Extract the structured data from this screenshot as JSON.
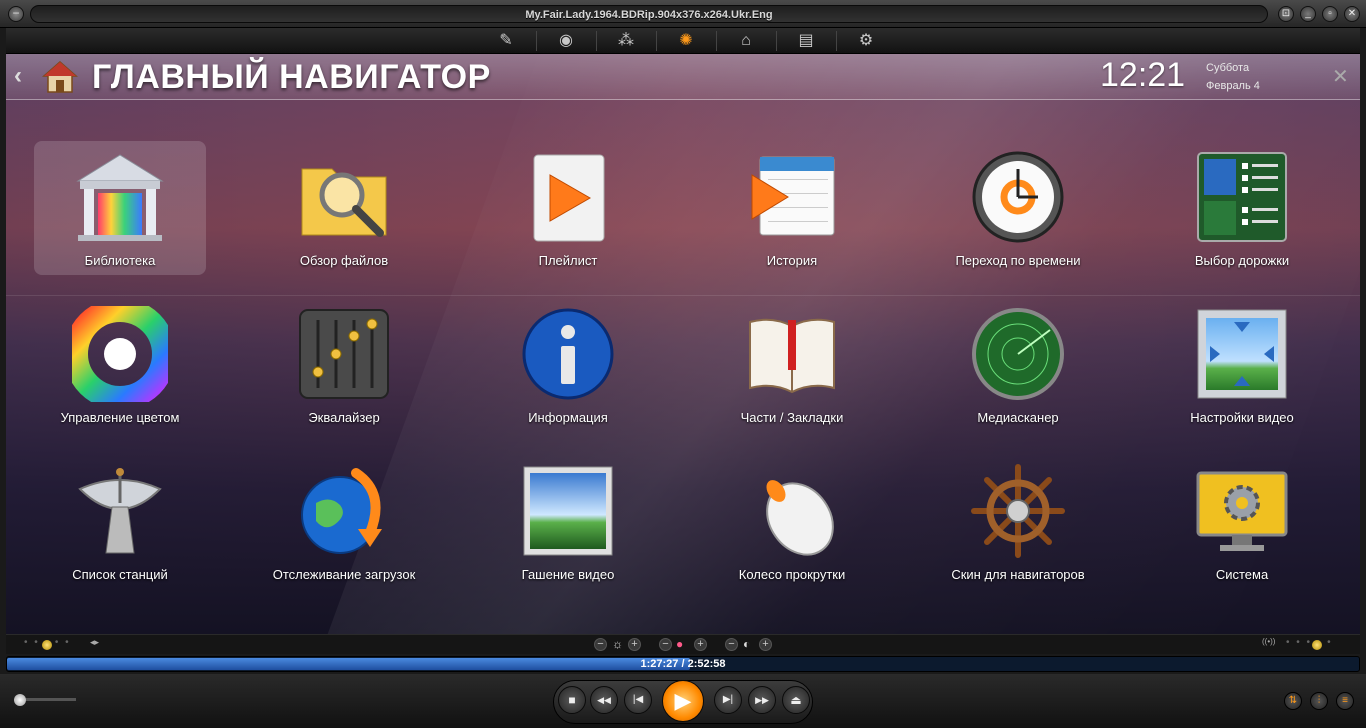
{
  "window": {
    "title": "My.Fair.Lady.1964.BDRip.904x376.x264.Ukr.Eng",
    "menu_glyph": "−",
    "btn_small": "⊡",
    "btn_minimize": "_",
    "btn_maximize": "▫",
    "btn_close": "✕"
  },
  "toolbar": {
    "items": [
      {
        "icon": "brush-icon",
        "glyph": "✎"
      },
      {
        "icon": "broadcast-icon",
        "glyph": "◉"
      },
      {
        "icon": "dots-icon",
        "glyph": "⁂"
      },
      {
        "icon": "navigator-icon",
        "glyph": "✺",
        "active": true
      },
      {
        "icon": "library-icon",
        "glyph": "⌂"
      },
      {
        "icon": "book-icon",
        "glyph": "▤"
      },
      {
        "icon": "settings-icon",
        "glyph": "⚙"
      }
    ]
  },
  "header": {
    "back_glyph": "‹",
    "title": "ГЛАВНЫЙ НАВИГАТОР",
    "time": "12:21",
    "day": "Суббота",
    "date": "Февраль 4",
    "close_glyph": "✕"
  },
  "grid": [
    {
      "label": "Библиотека",
      "icon": "library-icon",
      "selected": true
    },
    {
      "label": "Обзор файлов",
      "icon": "folder-search-icon"
    },
    {
      "label": "Плейлист",
      "icon": "playlist-icon"
    },
    {
      "label": "История",
      "icon": "calendar-history-icon"
    },
    {
      "label": "Переход по времени",
      "icon": "clock-icon"
    },
    {
      "label": "Выбор дорожки",
      "icon": "track-select-icon"
    },
    {
      "label": "Управление цветом",
      "icon": "color-wheel-icon"
    },
    {
      "label": "Эквалайзер",
      "icon": "equalizer-icon"
    },
    {
      "label": "Информация",
      "icon": "info-icon"
    },
    {
      "label": "Части / Закладки",
      "icon": "bookmark-book-icon"
    },
    {
      "label": "Медиасканер",
      "icon": "radar-icon"
    },
    {
      "label": "Настройки видео",
      "icon": "video-settings-icon"
    },
    {
      "label": "Список станций",
      "icon": "satellite-dish-icon"
    },
    {
      "label": "Отслеживание загрузок",
      "icon": "globe-download-icon"
    },
    {
      "label": "Гашение видео",
      "icon": "video-blank-icon"
    },
    {
      "label": "Колесо прокрутки",
      "icon": "mouse-icon"
    },
    {
      "label": "Скин для навигаторов",
      "icon": "ship-wheel-icon"
    },
    {
      "label": "Система",
      "icon": "monitor-gear-icon"
    }
  ],
  "strip": {
    "arrows_glyph": "◂▸",
    "minus_glyph": "−",
    "plus_glyph": "+",
    "brightness_glyph": "☼",
    "saturation_glyph": "●",
    "contrast_glyph": "◐",
    "broadcast_glyph": "((•))"
  },
  "playback": {
    "current": "1:27:27",
    "total": "2:52:58",
    "time_text": "1:27:27 / 2:52:58",
    "progress": 0.505
  },
  "controls": {
    "stop": "■",
    "rewind": "◀◀",
    "prev": "|◀",
    "play": "▶",
    "next": "▶|",
    "forward": "▶▶",
    "open": "⏏",
    "right": [
      "⇅",
      "⫶",
      "≡"
    ]
  },
  "colors": {
    "accent": "#ff9a1a",
    "progress": "#2f6bd0"
  }
}
